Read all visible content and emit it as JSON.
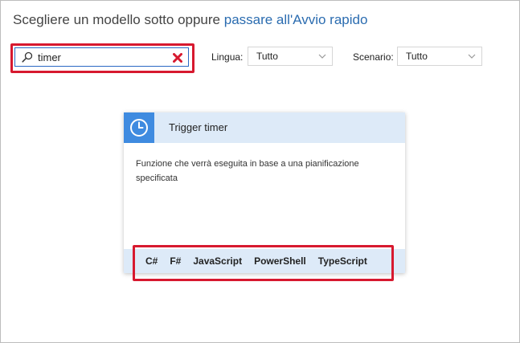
{
  "header": {
    "prefix": "Scegliere un modello sotto oppure ",
    "link": "passare all'Avvio rapido"
  },
  "search": {
    "value": "timer",
    "placeholder": ""
  },
  "filters": {
    "language_label": "Lingua:",
    "language_value": "Tutto",
    "scenario_label": "Scenario:",
    "scenario_value": "Tutto"
  },
  "template_card": {
    "title": "Trigger timer",
    "description": "Funzione che verrà eseguita in base a una pianificazione specificata",
    "languages": [
      "C#",
      "F#",
      "JavaScript",
      "PowerShell",
      "TypeScript"
    ]
  },
  "colors": {
    "accent": "#3f8be0",
    "link": "#2b6cb0",
    "highlight": "#d7192f",
    "card_band": "#ddeaf8",
    "clear_icon": "#d7192f"
  },
  "icons": {
    "search": "search-icon",
    "clear": "close-icon",
    "dropdown": "chevron-down-icon",
    "card": "clock-icon"
  }
}
